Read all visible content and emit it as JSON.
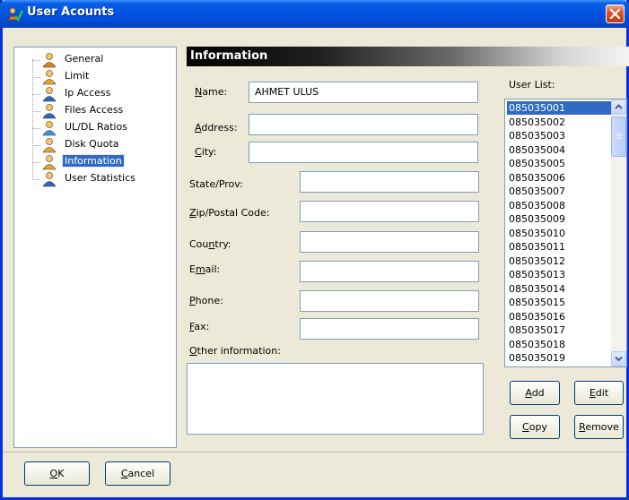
{
  "window": {
    "title": "User Acounts"
  },
  "tree": {
    "items": [
      {
        "label": "General",
        "icon": "users-icon",
        "selected": false
      },
      {
        "label": "Limit",
        "icon": "user-limit-icon",
        "selected": false
      },
      {
        "label": "Ip Access",
        "icon": "user-network-icon",
        "selected": false
      },
      {
        "label": "Files Access",
        "icon": "user-files-icon",
        "selected": false
      },
      {
        "label": "UL/DL Ratios",
        "icon": "document-ratio-icon",
        "selected": false
      },
      {
        "label": "Disk Quota",
        "icon": "user-disk-icon",
        "selected": false
      },
      {
        "label": "Information",
        "icon": "user-info-icon",
        "selected": true
      },
      {
        "label": "User Statistics",
        "icon": "user-stats-icon",
        "selected": false
      }
    ]
  },
  "info": {
    "header": "Information",
    "name_label": "Name:",
    "name_value": "AHMET ULUS",
    "address_label": "Address:",
    "address_value": "",
    "city_label": "City:",
    "city_value": "",
    "state_label": "State/Prov:",
    "state_value": "",
    "zip_label": "Zip/Postal Code:",
    "zip_value": "",
    "country_label": "Country:",
    "country_value": "",
    "email_label": "Email:",
    "email_value": "",
    "phone_label": "Phone:",
    "phone_value": "",
    "fax_label": "Fax:",
    "fax_value": "",
    "other_label": "Other information:",
    "other_value": ""
  },
  "userlist": {
    "label": "User List:",
    "items": [
      "085035001",
      "085035002",
      "085035003",
      "085035004",
      "085035005",
      "085035006",
      "085035007",
      "085035008",
      "085035009",
      "085035010",
      "085035011",
      "085035012",
      "085035013",
      "085035014",
      "085035015",
      "085035016",
      "085035017",
      "085035018",
      "085035019"
    ],
    "selected_index": 0
  },
  "buttons": {
    "add": "Add",
    "edit": "Edit",
    "copy": "Copy",
    "remove": "Remove",
    "ok": "OK",
    "cancel": "Cancel"
  }
}
